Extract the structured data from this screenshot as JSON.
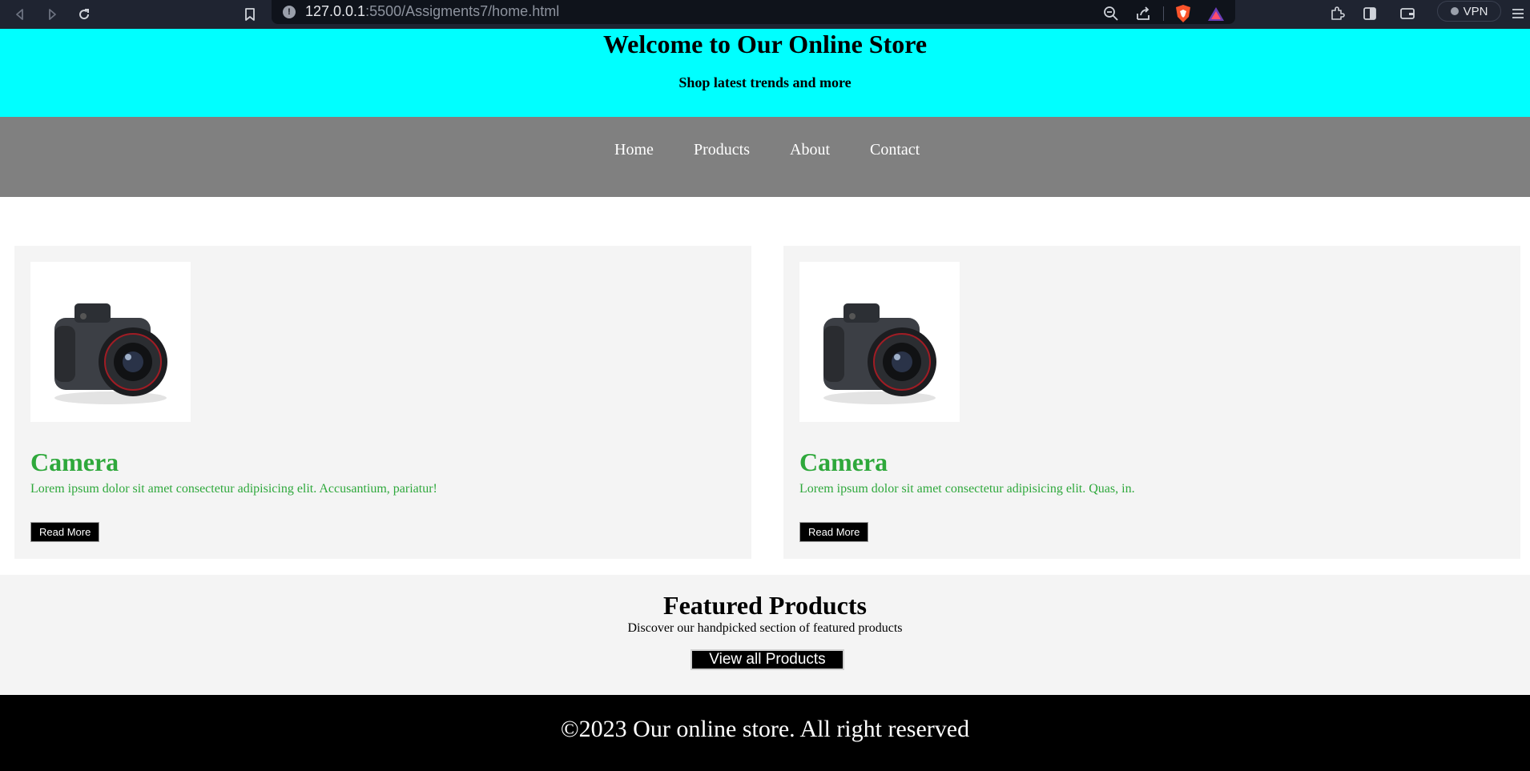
{
  "browser": {
    "url_host": "127.0.0.1",
    "url_rest": ":5500/Assigments7/home.html",
    "vpn_label": "VPN",
    "icons": [
      "back-icon",
      "forward-icon",
      "reload-icon",
      "bookmark-icon",
      "site-info-icon",
      "zoom-out-icon",
      "share-icon",
      "brave-shield-icon",
      "brave-rewards-icon",
      "extensions-icon",
      "sidebar-icon",
      "wallet-icon",
      "menu-icon"
    ]
  },
  "header": {
    "title": "Welcome to Our Online Store",
    "subtitle": "Shop latest trends and more",
    "background": "#00ffff"
  },
  "nav": {
    "items": [
      {
        "label": "Home"
      },
      {
        "label": "Products"
      },
      {
        "label": "About"
      },
      {
        "label": "Contact"
      }
    ],
    "background": "#808080"
  },
  "products": [
    {
      "title": "Camera",
      "description": "Lorem ipsum dolor sit amet consectetur adipisicing elit. Accusantium, pariatur!",
      "button": "Read More"
    },
    {
      "title": "Camera",
      "description": "Lorem ipsum dolor sit amet consectetur adipisicing elit. Quas, in.",
      "button": "Read More"
    }
  ],
  "featured": {
    "title": "Featured Products",
    "text": "Discover our handpicked section of featured products",
    "button": "View all Products"
  },
  "footer": {
    "text": "©2023 Our online store. All right reserved"
  },
  "colors": {
    "accent_green": "#2ea83b",
    "card_bg": "#f4f4f4",
    "footer_bg": "#000000"
  }
}
